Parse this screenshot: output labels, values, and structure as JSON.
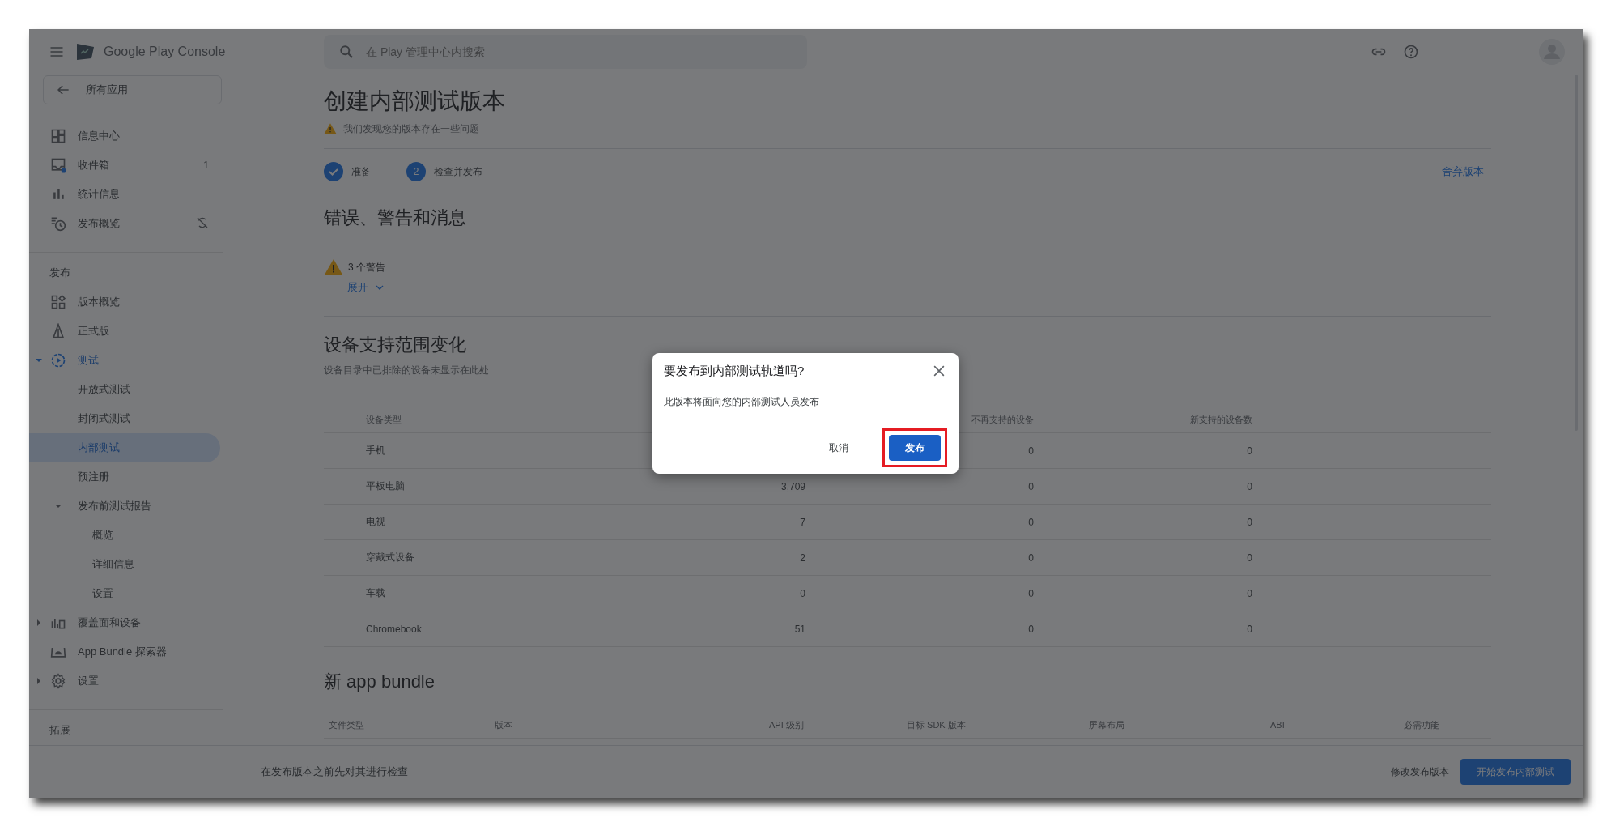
{
  "app_bar": {
    "product_name": "Google Play Console",
    "search": {
      "placeholder": "在 Play 管理中心内搜索"
    }
  },
  "sidebar": {
    "back_button": "所有应用",
    "groups": [
      {
        "items": [
          {
            "label": "信息中心",
            "selected": false
          },
          {
            "label": "收件箱",
            "badge": "1",
            "selected": false
          },
          {
            "label": "统计信息",
            "selected": false
          },
          {
            "label": "发布概览",
            "selected": false
          }
        ]
      },
      {
        "heading": "发布",
        "items": [
          {
            "label": "版本概览",
            "selected": false
          },
          {
            "label": "正式版",
            "selected": false
          },
          {
            "label": "测试",
            "selected": false,
            "expanded": true,
            "children": [
              {
                "label": "开放式测试",
                "selected": false
              },
              {
                "label": "封闭式测试",
                "selected": false
              },
              {
                "label": "内部测试",
                "selected": true
              },
              {
                "label": "预注册",
                "selected": false
              },
              {
                "label": "发布前测试报告",
                "selected": false,
                "expanded": true,
                "children": [
                  {
                    "label": "概览",
                    "selected": false
                  },
                  {
                    "label": "详细信息",
                    "selected": false
                  },
                  {
                    "label": "设置",
                    "selected": false
                  }
                ]
              }
            ]
          },
          {
            "label": "覆盖面和设备",
            "selected": false,
            "expanded": false
          },
          {
            "label": "App Bundle 探索器",
            "selected": false
          },
          {
            "label": "设置",
            "selected": false,
            "expanded": false
          }
        ]
      },
      {
        "heading": "拓展"
      }
    ]
  },
  "page": {
    "title": "创建内部测试版本",
    "warning": "我们发现您的版本存在一些问题",
    "steps": [
      {
        "label": "准备",
        "done": true
      },
      {
        "label": "检查并发布",
        "number": "2",
        "done": false
      }
    ],
    "discard_link": "舍弃版本",
    "messages": {
      "title": "错误、警告和消息",
      "warning_count": "3 个警告",
      "expand_link": "展开"
    },
    "devices": {
      "title": "设备支持范围变化",
      "subtitle": "设备目录中已排除的设备未显示在此处",
      "columns": [
        "设备类型",
        "不再支持的设备",
        "新支持的设备数"
      ],
      "rows": [
        {
          "type": "手机",
          "unsupported": "0",
          "new": "0"
        },
        {
          "type": "平板电脑",
          "count": "3,709",
          "unsupported": "0",
          "new": "0"
        },
        {
          "type": "电视",
          "count": "7",
          "unsupported": "0",
          "new": "0"
        },
        {
          "type": "穿戴式设备",
          "count": "2",
          "unsupported": "0",
          "new": "0"
        },
        {
          "type": "车载",
          "count": "0",
          "unsupported": "0",
          "new": "0"
        },
        {
          "type": "Chromebook",
          "count": "51",
          "unsupported": "0",
          "new": "0"
        }
      ]
    },
    "bundle": {
      "title": "新 app bundle",
      "columns": [
        "文件类型",
        "版本",
        "API 级别",
        "目标 SDK 版本",
        "屏幕布局",
        "ABI",
        "必需功能"
      ]
    }
  },
  "footer": {
    "message": "在发布版本之前先对其进行检查",
    "secondary_button": "修改发布版本",
    "primary_button": "开始发布内部测试"
  },
  "dialog": {
    "title": "要发布到内部测试轨道吗?",
    "body": "此版本将面向您的内部测试人员发布",
    "buttons": [
      {
        "label": "取消",
        "kind": "text",
        "highlighted": false
      },
      {
        "label": "发布",
        "kind": "filled",
        "highlighted": true
      }
    ]
  }
}
